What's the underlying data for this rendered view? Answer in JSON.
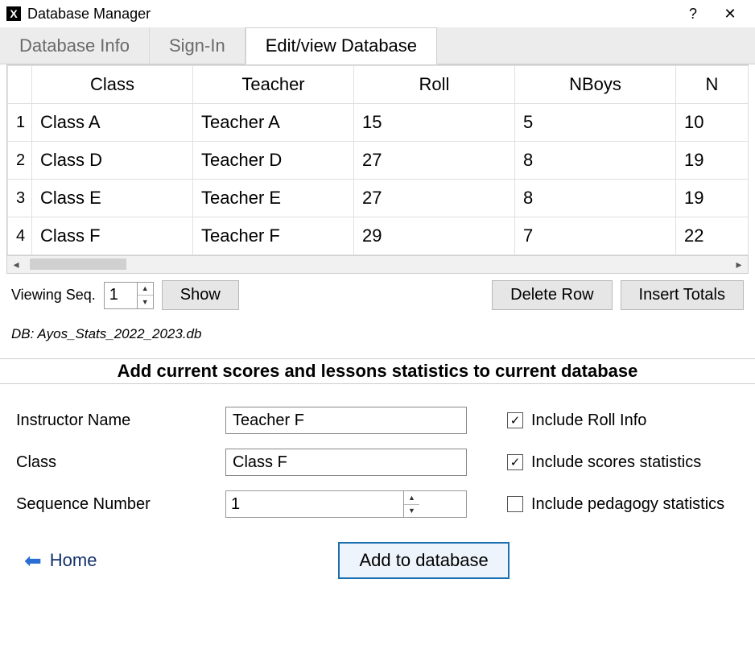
{
  "window": {
    "title": "Database Manager",
    "help": "?",
    "close": "✕"
  },
  "tabs": [
    {
      "label": "Database Info",
      "active": false
    },
    {
      "label": "Sign-In",
      "active": false
    },
    {
      "label": "Edit/view Database",
      "active": true
    }
  ],
  "table": {
    "columns": [
      "Class",
      "Teacher",
      "Roll",
      "NBoys",
      "N"
    ],
    "rows": [
      {
        "idx": "1",
        "cells": [
          "Class A",
          "Teacher A",
          "15",
          "5",
          "10"
        ]
      },
      {
        "idx": "2",
        "cells": [
          "Class D",
          "Teacher D",
          "27",
          "8",
          "19"
        ]
      },
      {
        "idx": "3",
        "cells": [
          "Class E",
          "Teacher E",
          "27",
          "8",
          "19"
        ]
      },
      {
        "idx": "4",
        "cells": [
          "Class F",
          "Teacher F",
          "29",
          "7",
          "22"
        ]
      }
    ]
  },
  "toolbar": {
    "viewing_seq_label": "Viewing Seq.",
    "viewing_seq_value": "1",
    "show": "Show",
    "delete_row": "Delete Row",
    "insert_totals": "Insert Totals"
  },
  "db_line": "DB: Ayos_Stats_2022_2023.db",
  "section_header": "Add current scores and lessons statistics to current database",
  "form": {
    "instructor_label": "Instructor Name",
    "instructor_value": "Teacher F",
    "class_label": "Class",
    "class_value": "Class F",
    "seq_label": "Sequence Number",
    "seq_value": "1",
    "chk_roll": {
      "checked": true,
      "label": "Include Roll Info"
    },
    "chk_scores": {
      "checked": true,
      "label": "Include  scores statistics"
    },
    "chk_pedagogy": {
      "checked": false,
      "label": "Include pedagogy statistics"
    },
    "add_btn": "Add to database"
  },
  "home_label": "Home"
}
